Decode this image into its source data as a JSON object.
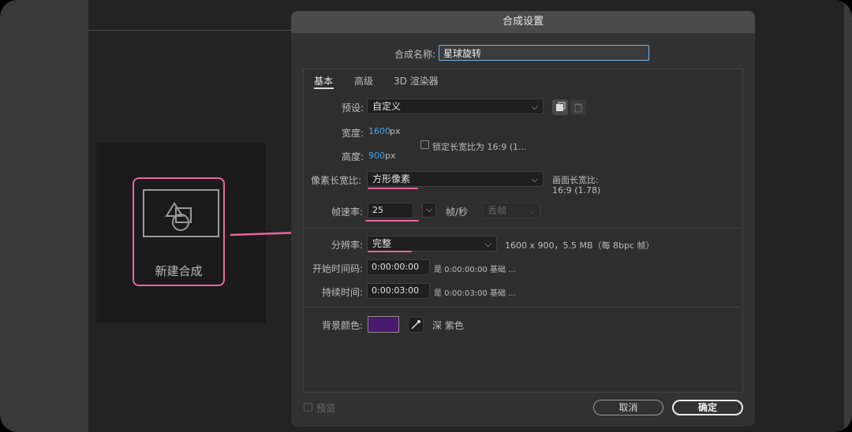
{
  "left": {
    "new_comp_label": "新建合成"
  },
  "dialog": {
    "title": "合成设置",
    "comp_name_label": "合成名称:",
    "comp_name_value": "星球旋转",
    "tabs": [
      "基本",
      "高级",
      "3D 渲染器"
    ],
    "preset_label": "预设:",
    "preset_value": "自定义",
    "width_label": "宽度:",
    "width_value": "1600",
    "height_label": "高度:",
    "height_value": "900",
    "px_unit": "px",
    "lock_aspect_label": "锁定长宽比为 16:9 (1...",
    "par_label": "像素长宽比:",
    "par_value": "方形像素",
    "frame_aspect_label": "画面长宽比:",
    "frame_aspect_value": "16:9 (1.78)",
    "fps_label": "帧速率:",
    "fps_value": "25",
    "fps_unit": "帧/秒",
    "drop_frame_value": "丢帧",
    "resolution_label": "分辨率:",
    "resolution_value": "完整",
    "resolution_info": "1600 x 900，5.5 MB（每 8bpc 帧）",
    "start_tc_label": "开始时间码:",
    "start_tc_value": "0:00:00:00",
    "start_tc_info": "是 0:00:00:00  基础 ...",
    "duration_label": "持续时间:",
    "duration_value": "0:00:03:00",
    "duration_info": "是 0:00:03:00  基础 ...",
    "bg_color_label": "背景颜色:",
    "bg_color_name": "深 紫色",
    "bg_color_hex": "#4a1a6e",
    "preview_label": "预览",
    "cancel_label": "取消",
    "ok_label": "确定"
  }
}
